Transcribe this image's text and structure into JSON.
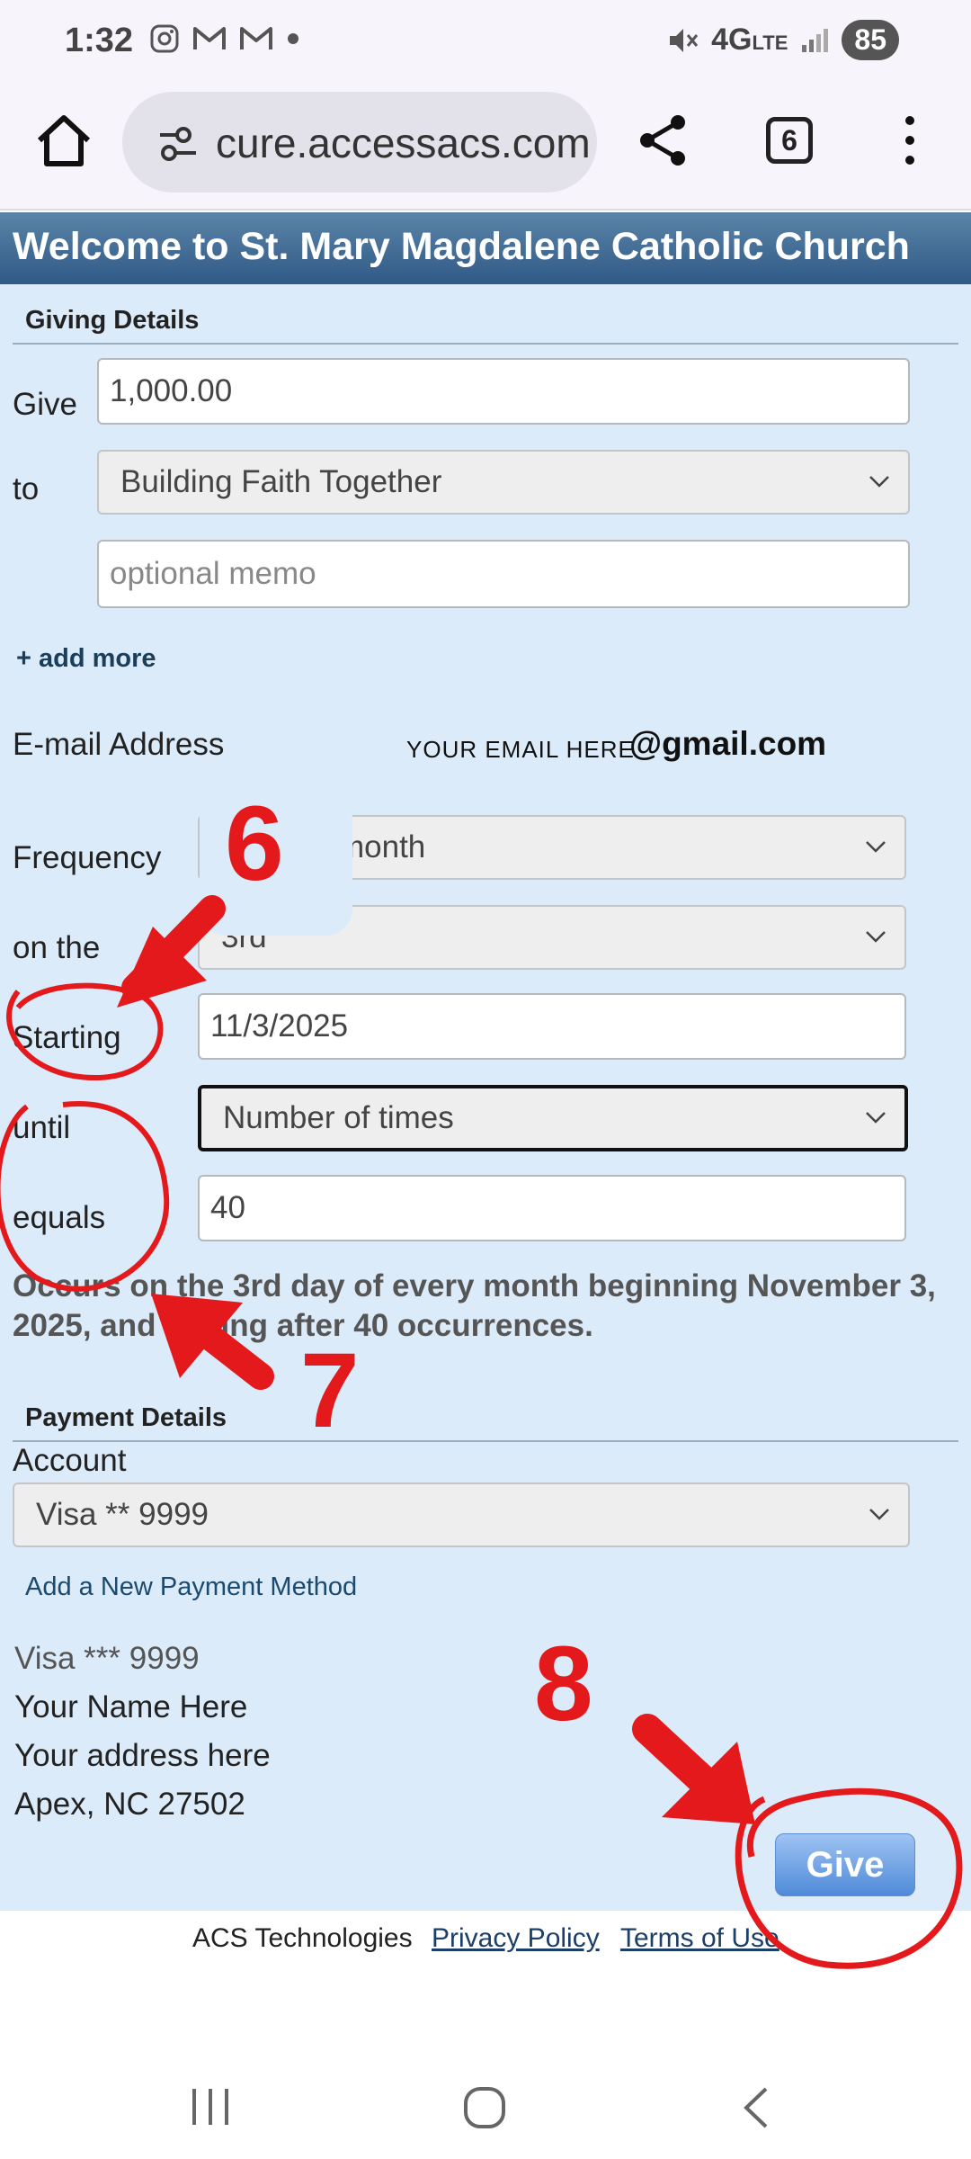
{
  "status_bar": {
    "time": "1:32",
    "network": "4G",
    "network_sub": "LTE",
    "battery": "85",
    "icons": [
      "instagram-icon",
      "gmail-icon",
      "gmail-icon",
      "dot-icon",
      "mute-icon",
      "signal-icon"
    ]
  },
  "browser": {
    "url": "cure.accessacs.com",
    "tab_count": "6"
  },
  "page": {
    "header_title": "Welcome to St. Mary Magdalene Catholic Church",
    "giving_section": "Giving Details",
    "give_label": "Give",
    "give_amount": "1,000.00",
    "to_label": "to",
    "fund_selected": "Building Faith Together",
    "memo_placeholder": "optional memo",
    "add_more": "+ add more",
    "email_label": "E-mail Address",
    "email_hint": "YOUR EMAIL HERE",
    "email_domain": "@gmail.com",
    "frequency_label": "Frequency",
    "frequency_value": "month",
    "on_the_label": "on the",
    "on_the_value": "3rd",
    "starting_label": "Starting",
    "starting_value": "11/3/2025",
    "until_label": "until",
    "until_value": "Number of times",
    "equals_label": "equals",
    "equals_value": "40",
    "summary": "Occurs on the 3rd day of every month beginning November 3, 2025, and ending after 40 occurrences.",
    "payment_section": "Payment Details",
    "account_label": "Account",
    "account_value": "Visa ** 9999",
    "add_payment": "Add a New Payment Method",
    "card_line": "Visa *** 9999",
    "name_line": "Your Name Here",
    "address_line": "Your address here",
    "city_line": "Apex, NC 27502",
    "give_button": "Give"
  },
  "footer": {
    "company": "ACS Technologies",
    "privacy": "Privacy Policy",
    "terms": "Terms of Use"
  },
  "annotations": {
    "step6": "6",
    "step7": "7",
    "step8": "8",
    "color": "#e3191b"
  },
  "colors": {
    "header": "#2f5a86",
    "page_bg": "#dcebfa",
    "button": "#4f8ad8"
  }
}
